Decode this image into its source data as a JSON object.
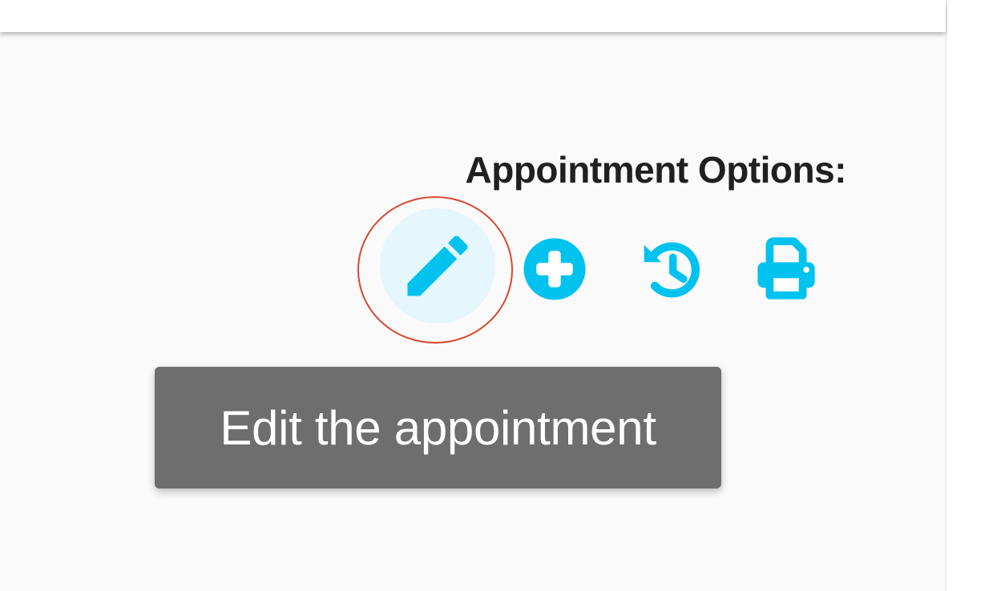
{
  "theme": {
    "accent": "#00c2ef",
    "tooltip_bg": "#6e6e6e",
    "focus_ring": "#d9472f"
  },
  "appointment_options": {
    "heading": "Appointment Options:",
    "actions": [
      {
        "id": "edit",
        "icon": "pencil-icon",
        "state": "hovered"
      },
      {
        "id": "add",
        "icon": "plus-circle-icon"
      },
      {
        "id": "history",
        "icon": "history-icon"
      },
      {
        "id": "print",
        "icon": "printer-icon"
      }
    ]
  },
  "tooltip": {
    "text": "Edit the appointment"
  }
}
